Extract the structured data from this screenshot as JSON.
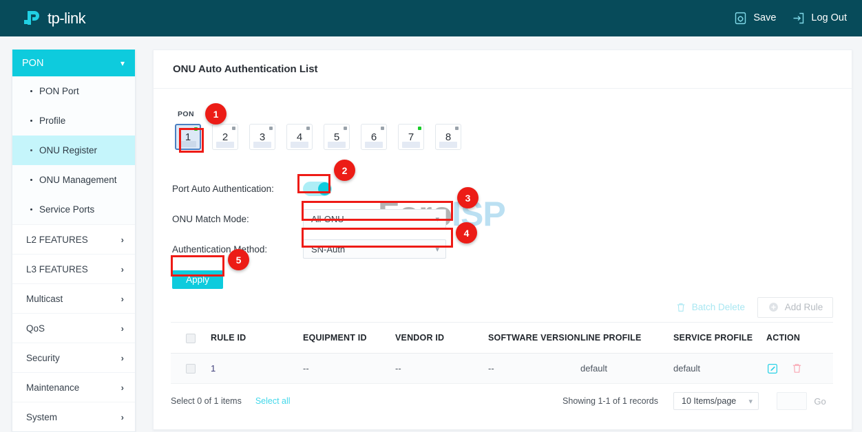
{
  "header": {
    "brand": "tp-link",
    "save_label": "Save",
    "logout_label": "Log Out",
    "save_icon": "save-gear-icon",
    "logout_icon": "exit-arrow-icon",
    "background": "#074b5a"
  },
  "sidebar": {
    "group_label": "PON",
    "group_icon": "chevron-down-icon",
    "sub_items": [
      {
        "label": "PON Port",
        "active": false
      },
      {
        "label": "Profile",
        "active": false
      },
      {
        "label": "ONU Register",
        "active": true
      },
      {
        "label": "ONU Management",
        "active": false
      },
      {
        "label": "Service Ports",
        "active": false
      }
    ],
    "groups": [
      {
        "label": "L2 FEATURES"
      },
      {
        "label": "L3 FEATURES"
      },
      {
        "label": "Multicast"
      },
      {
        "label": "QoS"
      },
      {
        "label": "Security"
      },
      {
        "label": "Maintenance"
      },
      {
        "label": "System"
      }
    ],
    "group_icon_collapsed": "chevron-right-icon",
    "active_color": "#c5f5fb",
    "head_color": "#0ecbdd"
  },
  "watermark": {
    "part1": "Foro",
    "part2": "ISP"
  },
  "page": {
    "title": "ONU Auto Authentication List",
    "pon_label": "PON",
    "ports": [
      {
        "num": "1",
        "status": "up",
        "selected": true
      },
      {
        "num": "2",
        "status": "down",
        "selected": false
      },
      {
        "num": "3",
        "status": "down",
        "selected": false
      },
      {
        "num": "4",
        "status": "down",
        "selected": false
      },
      {
        "num": "5",
        "status": "down",
        "selected": false
      },
      {
        "num": "6",
        "status": "down",
        "selected": false
      },
      {
        "num": "7",
        "status": "up",
        "selected": false
      },
      {
        "num": "8",
        "status": "down",
        "selected": false
      }
    ],
    "form": {
      "auto_auth_label": "Port Auto Authentication:",
      "auto_auth_state": "on",
      "match_mode_label": "ONU Match Mode:",
      "match_mode_value": "All-ONU",
      "auth_method_label": "Authentication Method:",
      "auth_method_value": "SN-Auth",
      "apply_label": "Apply",
      "dropdown_icon": "chevron-down-icon"
    }
  },
  "toolbar": {
    "batch_delete_label": "Batch Delete",
    "batch_delete_icon": "trash-icon",
    "add_rule_label": "Add Rule",
    "add_rule_icon": "plus-circle-icon"
  },
  "table": {
    "columns": [
      "RULE ID",
      "EQUIPMENT ID",
      "VENDOR ID",
      "SOFTWARE VERSION",
      "LINE PROFILE",
      "SERVICE PROFILE",
      "ACTION"
    ],
    "rows": [
      {
        "rule_id": "1",
        "equipment_id": "--",
        "vendor_id": "--",
        "software_version": "--",
        "line_profile": "default",
        "service_profile": "default",
        "edit_icon": "edit-pencil-icon",
        "delete_icon": "trash-icon"
      }
    ]
  },
  "footer": {
    "select_info": "Select 0 of 1 items",
    "select_all": "Select all",
    "showing": "Showing 1-1 of 1 records",
    "page_size": "10 Items/page",
    "page_input_value": "",
    "go_label": "Go"
  },
  "annotations": [
    {
      "num": "1"
    },
    {
      "num": "2"
    },
    {
      "num": "3"
    },
    {
      "num": "4"
    },
    {
      "num": "5"
    }
  ]
}
